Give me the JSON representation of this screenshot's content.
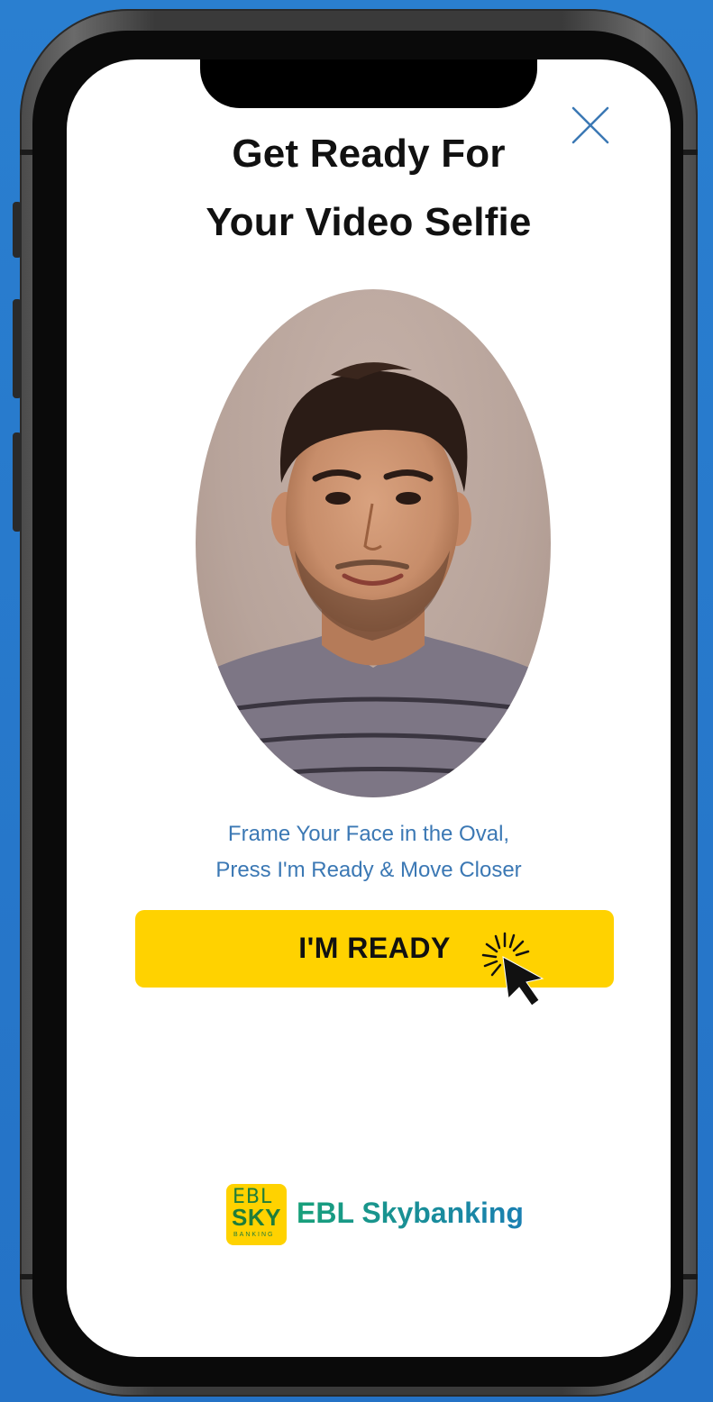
{
  "screen": {
    "title_line1": "Get Ready For",
    "title_line2": "Your Video Selfie",
    "close_icon": "close-icon",
    "instruction_line1": "Frame Your Face in the Oval,",
    "instruction_line2": "Press I'm Ready & Move Closer",
    "ready_button_label": "I'M READY",
    "cursor_icon": "click-cursor-icon"
  },
  "branding": {
    "logo_line1": "EBL",
    "logo_line2": "SKY",
    "logo_line3": "BANKING",
    "brand_name": "EBL Skybanking"
  },
  "colors": {
    "background": "#2472c6",
    "accent_button": "#ffd200",
    "instruction_text": "#3b78b4",
    "brand_green": "#1f7d3a",
    "brand_gradient_start": "#18a07a",
    "brand_gradient_end": "#1a7fb2"
  }
}
